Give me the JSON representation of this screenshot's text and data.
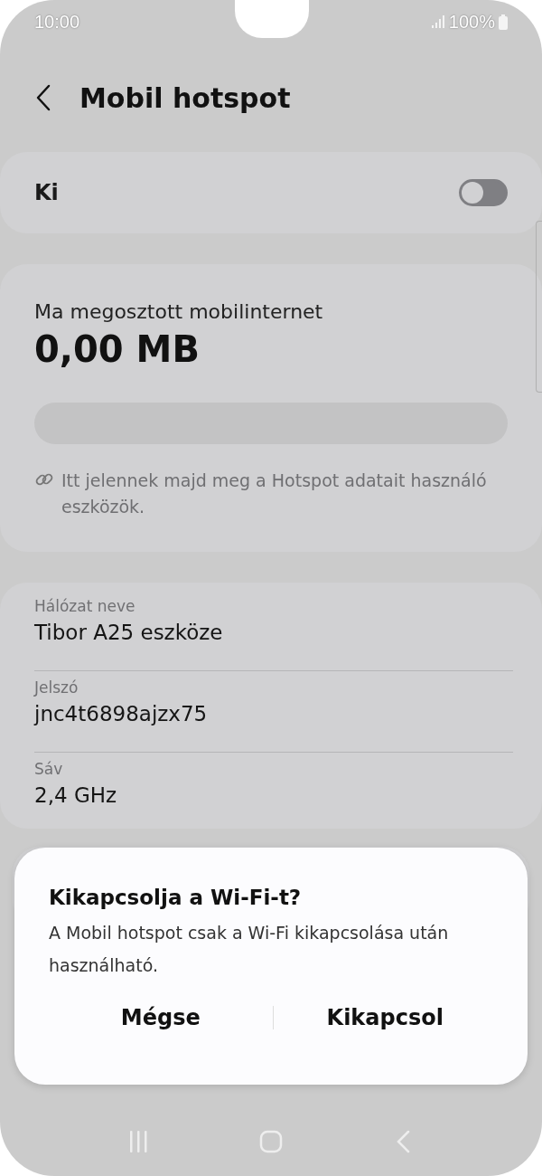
{
  "status_bar": {
    "time": "10:00",
    "battery": "100%"
  },
  "header": {
    "title": "Mobil hotspot"
  },
  "master_switch": {
    "label": "Ki",
    "on": false
  },
  "usage": {
    "label": "Ma megosztott mobilinternet",
    "amount": "0,00 MB",
    "level": 0,
    "note": "Itt jelennek majd meg a Hotspot adatait használó eszközök."
  },
  "settings": [
    {
      "label": "Hálózat neve",
      "value": "Tibor A25 eszköze"
    },
    {
      "label": "Jelszó",
      "value": "jnc4t6898ajzx75"
    },
    {
      "label": "Sáv",
      "value": "2,4 GHz"
    }
  ],
  "dialog": {
    "title": "Kikapcsolja a Wi-Fi-t?",
    "message": "A Mobil hotspot csak a Wi-Fi kikapcsolása után használható.",
    "buttons": [
      "Mégse",
      "Kikapcsol"
    ]
  }
}
